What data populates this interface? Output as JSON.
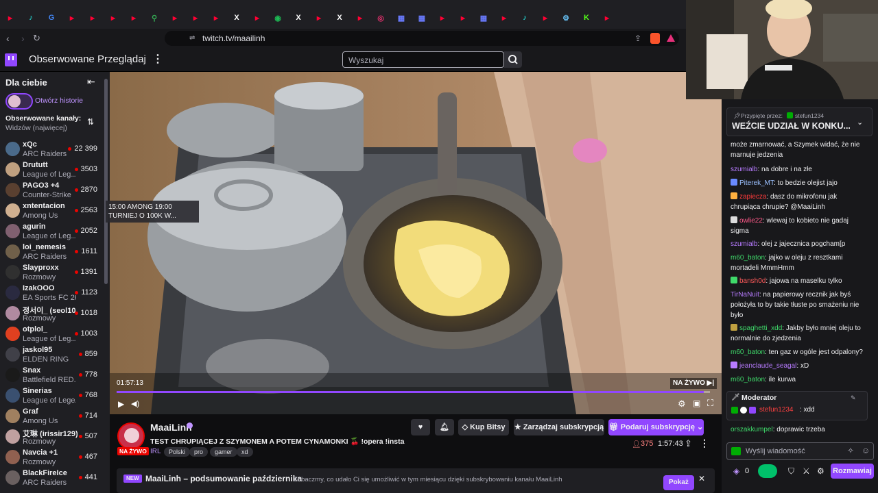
{
  "browser": {
    "url": "twitch.tv/maailinh",
    "tabs": [
      "youtube",
      "tiktok",
      "google",
      "youtube",
      "youtube",
      "youtube",
      "youtube",
      "maps",
      "youtube",
      "youtube",
      "youtube",
      "x",
      "youtube",
      "spotify",
      "x",
      "youtube",
      "x",
      "youtube",
      "instagram",
      "app",
      "app",
      "youtube",
      "youtube",
      "app",
      "youtube",
      "tiktok",
      "youtube",
      "steam",
      "kick",
      "youtube"
    ]
  },
  "topnav": {
    "followed": "Obserwowane",
    "browse": "Przeglądaj",
    "search_placeholder": "Wyszukaj"
  },
  "sidebar": {
    "title": "Dla ciebie",
    "stories": "Otwórz historie",
    "followed_title": "Obserwowane kanały:",
    "sort": "Widzów (najwięcej)",
    "channels": [
      {
        "name": "xQc",
        "game": "ARC Raiders",
        "viewers": "22 399",
        "color": "#4a6a8a"
      },
      {
        "name": "Drututt",
        "game": "League of Leg...",
        "viewers": "3503",
        "color": "#c0a080"
      },
      {
        "name": "PAGO3 +4",
        "game": "Counter-Strike",
        "viewers": "2870",
        "color": "#5a4030"
      },
      {
        "name": "xntentacion",
        "game": "Among Us",
        "viewers": "2563",
        "color": "#d0b090"
      },
      {
        "name": "agurin",
        "game": "League of Leg...",
        "viewers": "2052",
        "color": "#806070"
      },
      {
        "name": "loi_nemesis",
        "game": "ARC Raiders",
        "viewers": "1611",
        "color": "#70604a"
      },
      {
        "name": "Slayproxx",
        "game": "Rozmowy",
        "viewers": "1391",
        "color": "#303030"
      },
      {
        "name": "IzakOOO",
        "game": "EA Sports FC 26",
        "viewers": "1123",
        "color": "#2a2a40"
      },
      {
        "name": "정서이_ (seol10...",
        "game": "Rozmowy",
        "viewers": "1018",
        "color": "#b08aa0"
      },
      {
        "name": "otplol_",
        "game": "League of Leg...",
        "viewers": "1003",
        "color": "#e04020"
      },
      {
        "name": "jaskol95",
        "game": "ELDEN RING",
        "viewers": "859",
        "color": "#404048"
      },
      {
        "name": "Snax",
        "game": "Battlefield RED...",
        "viewers": "778",
        "color": "#1a1a1a"
      },
      {
        "name": "Sinerias",
        "game": "League of Lege...",
        "viewers": "768",
        "color": "#3a5070"
      },
      {
        "name": "Graf",
        "game": "Among Us",
        "viewers": "714",
        "color": "#a08060"
      },
      {
        "name": "艾琳 (irissir129)",
        "game": "Rozmowy",
        "viewers": "507",
        "color": "#c0a0a0"
      },
      {
        "name": "Navcia +1",
        "game": "Rozmowy",
        "viewers": "467",
        "color": "#906050"
      },
      {
        "name": "BlackFireIce",
        "game": "ARC Raiders",
        "viewers": "441",
        "color": "#6a6060"
      }
    ]
  },
  "player": {
    "tooltip_line1": "15:00 AMONG 19:00",
    "tooltip_line2": "TURNIEJ O 100K W...",
    "elapsed": "01:57:13",
    "live_label": "NA ŻYWO",
    "progress": 0.99
  },
  "stream": {
    "streamer": "MaaiLinh",
    "title": "TEST CHRUPIĄCEJ Z SZYMONEM A POTEM CYNAMONKI 🍒 !opera !insta",
    "live_badge": "NA ŻYWO",
    "category": "IRL",
    "tags": [
      "Polski",
      "pro",
      "gamer",
      "xd"
    ],
    "viewers": "375",
    "uptime": "1:57:43",
    "buttons": {
      "bits": "Kup Bitsy",
      "manage": "Zarządzaj subskrypcją",
      "gift": "Podaruj subskrypcję"
    }
  },
  "banner": {
    "new_label": "NEW",
    "title": "MaaiLinh – podsumowanie października",
    "text": "Zobaczmy, co udało Ci się umożliwić w tym miesiącu dzięki subskrybowaniu kanału MaaiLinh",
    "action": "Pokaż"
  },
  "chat": {
    "pinned_by": "Przypięte przez:",
    "pinned_user": "stefun1234",
    "pinned_text": "WEŹCIE UDZIAŁ W KONKU...",
    "lead_text": "może zmarnować, a Szymek widać, że nie marnuje jedzenia",
    "messages": [
      {
        "user": "szumialb",
        "color": "#b77bff",
        "text": ": na dobre i na złe"
      },
      {
        "user": "Piterek_MT",
        "color": "#9bc0ff",
        "text": ": to bedzie olejist jajo"
      },
      {
        "user": "zapiecza",
        "color": "#ff3b3b",
        "text": ": dasz do mikrofonu jak chrupiąca chrupie? @MaaiLinh"
      },
      {
        "user": "owlie22",
        "color": "#ff5a8a",
        "text": ": wlewaj to kobieto nie gadaj sigma"
      },
      {
        "user": "szumialb",
        "color": "#b77bff",
        "text": ": olej z jajecznica pogcham[p"
      },
      {
        "user": "m60_baton",
        "color": "#3fd96a",
        "text": ": jajko w oleju z resztkami mortadeli MmmHmm"
      },
      {
        "user": "bansh0d",
        "color": "#ff5a5a",
        "text": ": jajowa na maselku tylko"
      },
      {
        "user": "TirNaNuit",
        "color": "#b77bff",
        "text": ": na papierowy recznik jak byś położyła to by takie tłuste po smażeniu nie było"
      },
      {
        "user": "spaghetti_xdd",
        "color": "#3fd96a",
        "text": ": Jakby było mniej oleju to normalnie do zjedzenia"
      },
      {
        "user": "m60_baton",
        "color": "#3fd96a",
        "text": ": ten gaz w ogóle jest odpalony?"
      },
      {
        "user": "jeanclaude_seagal",
        "color": "#b77bff",
        "text": ": xD"
      },
      {
        "user": "m60_baton",
        "color": "#3fd96a",
        "text": ": ile kurwa"
      }
    ],
    "mod_label": "Moderator",
    "mod_user": "stefun1234",
    "mod_text": ": xdd",
    "last_user": "orszakkumpel",
    "last_color": "#3fd96a",
    "last_text": ": doprawic trzeba",
    "input_placeholder": "Wyślij wiadomość",
    "points": "0",
    "send": "Rozmawiaj"
  }
}
